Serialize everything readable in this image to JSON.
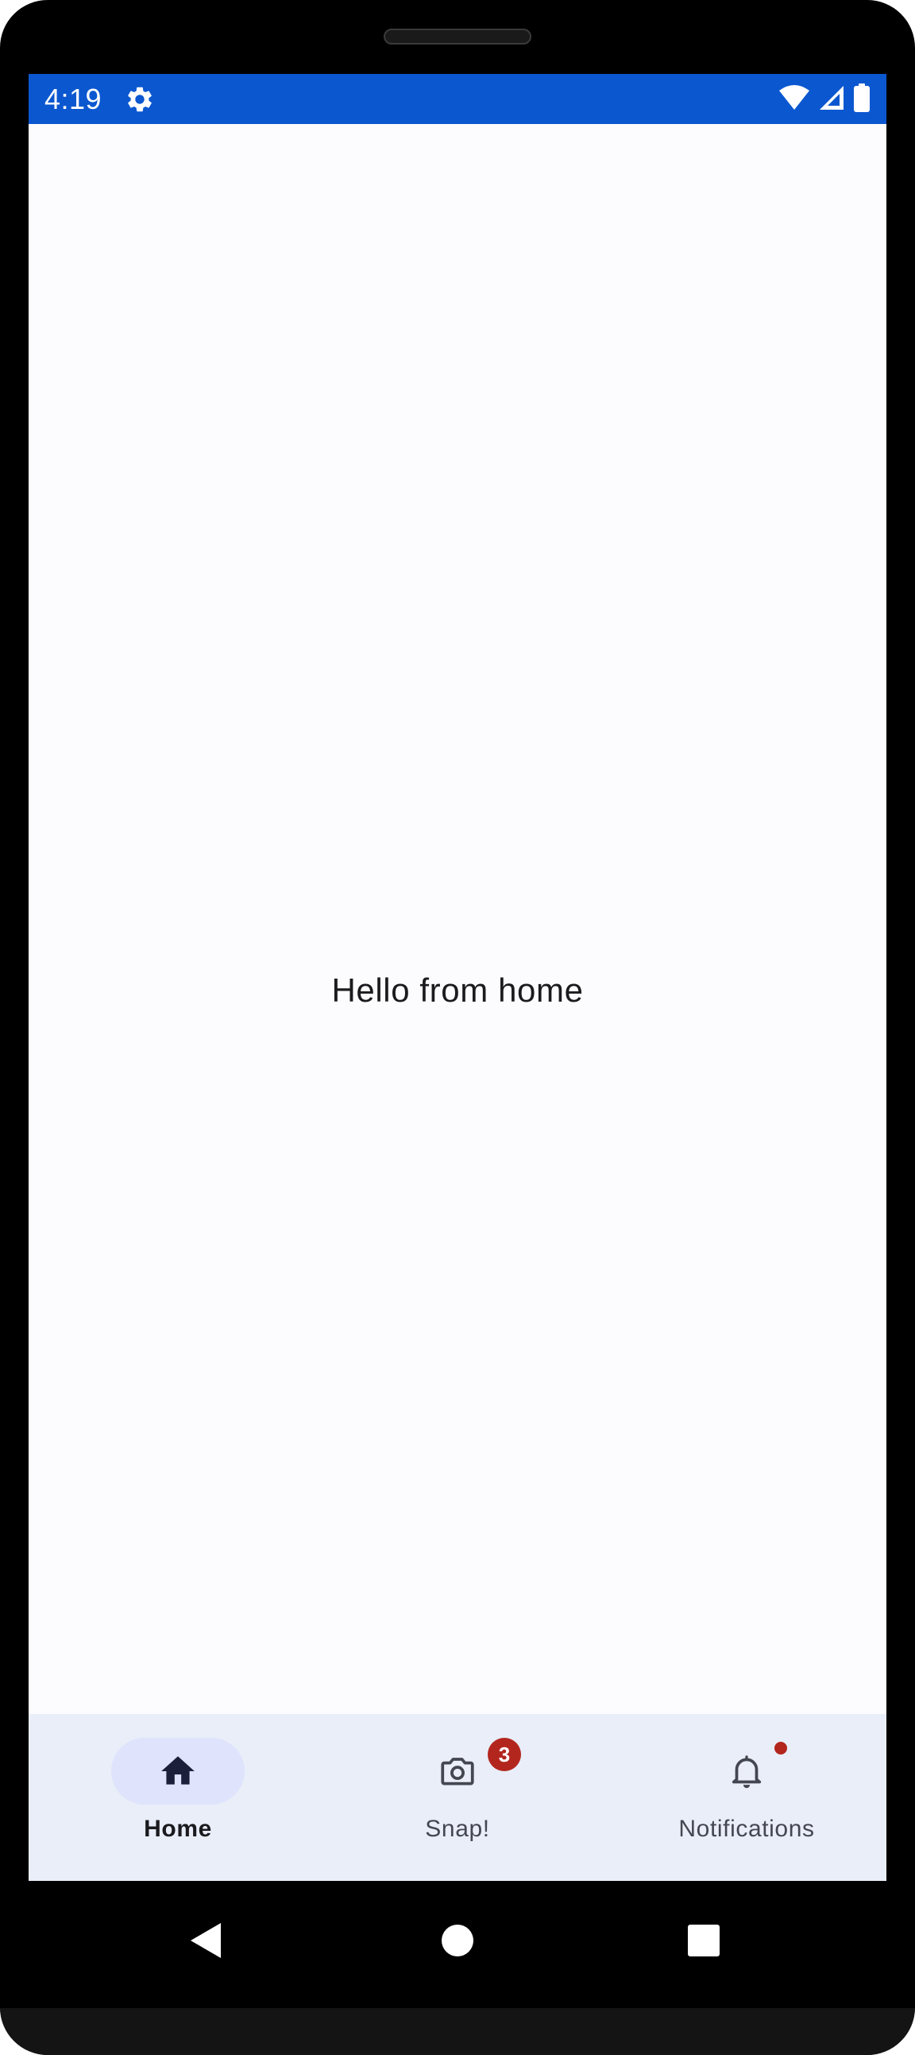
{
  "status_bar": {
    "time": "4:19",
    "settings_icon": "gear-icon",
    "wifi_icon": "wifi-icon",
    "signal_icon": "cell-signal-icon",
    "battery_icon": "battery-icon",
    "background_color": "#0b57d0"
  },
  "main": {
    "message": "Hello from home"
  },
  "bottom_nav": {
    "items": [
      {
        "label": "Home",
        "icon": "home-icon",
        "selected": true
      },
      {
        "label": "Snap!",
        "icon": "camera-icon",
        "selected": false,
        "badge": "3"
      },
      {
        "label": "Notifications",
        "icon": "bell-icon",
        "selected": false,
        "badge_dot": true
      }
    ],
    "background_color": "#e9eef9",
    "indicator_color": "#dfe3fb",
    "badge_color": "#b3261e"
  },
  "system_nav": {
    "back_icon": "back-triangle-icon",
    "home_icon": "home-circle-icon",
    "recents_icon": "recents-square-icon"
  }
}
